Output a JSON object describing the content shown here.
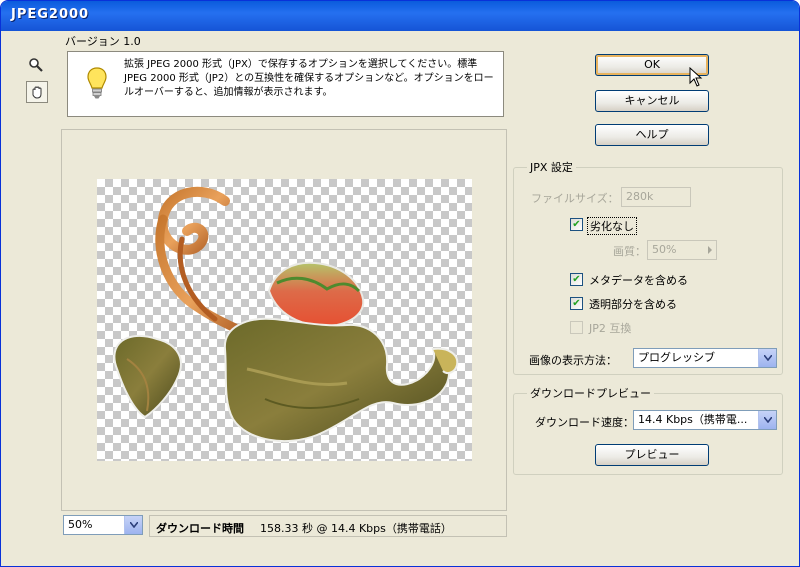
{
  "window": {
    "title": "JPEG2000"
  },
  "version": "バージョン 1.0",
  "info": {
    "text": "拡張 JPEG 2000 形式（JPX）で保存するオプションを選択してください。標準 JPEG 2000 形式（JP2）との互換性を確保するオプションなど。オプションをロールオーバーすると、追加情報が表示されます。"
  },
  "buttons": {
    "ok": "OK",
    "cancel": "キャンセル",
    "help": "ヘルプ",
    "preview": "プレビュー"
  },
  "jpx": {
    "legend": "JPX 設定",
    "filesize_label": "ファイルサイズ：",
    "filesize_value": "280k",
    "lossless_label": "劣化なし",
    "lossless_checked": true,
    "quality_label": "画質：",
    "quality_value": "50%",
    "metadata_label": "メタデータを含める",
    "metadata_checked": true,
    "transparency_label": "透明部分を含める",
    "transparency_checked": true,
    "jp2_label": "JP2 互換",
    "jp2_checked": false,
    "display_label": "画像の表示方法：",
    "display_value": "プログレッシブ"
  },
  "download": {
    "legend": "ダウンロードプレビュー",
    "speed_label": "ダウンロード速度：",
    "speed_value": "14.4 Kbps（携帯電..."
  },
  "status": {
    "zoom": "50%",
    "time_label": "ダウンロード時間",
    "time_value": "158.33 秒 @ 14.4 Kbps（携帯電話）"
  },
  "icons": {
    "zoom": "magnifier-icon",
    "hand": "hand-icon",
    "info": "lightbulb-icon"
  }
}
